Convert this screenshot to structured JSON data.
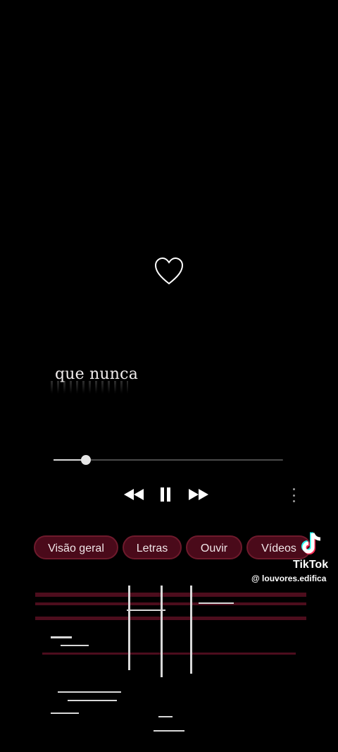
{
  "lyric": {
    "text": "que nunca"
  },
  "player": {
    "progress": 0.14,
    "controls": {
      "rewind": "rewind-icon",
      "play_pause": "pause-icon",
      "forward": "fast-forward-icon"
    },
    "more": "more-vertical-icon"
  },
  "chips": [
    {
      "label": "Visão geral"
    },
    {
      "label": "Letras"
    },
    {
      "label": "Ouvir"
    },
    {
      "label": "Vídeos"
    }
  ],
  "watermark": {
    "brand": "TikTok",
    "user": "@ louvores.edifica"
  },
  "colors": {
    "background": "#000000",
    "chip_bg": "#4a0a1a",
    "chip_border": "#6e1a2c"
  }
}
